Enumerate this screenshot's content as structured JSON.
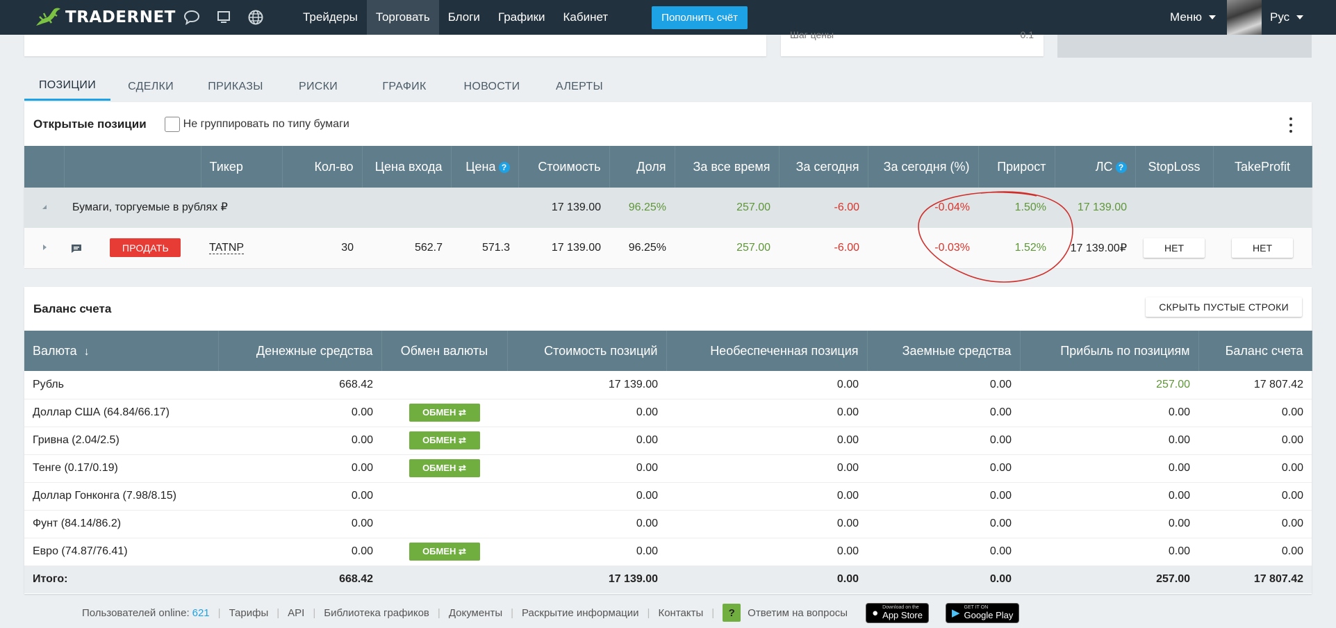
{
  "topbar": {
    "logo_text": "TRADERNET",
    "nav": [
      {
        "label": "Трейдеры"
      },
      {
        "label": "Торговать"
      },
      {
        "label": "Блоги"
      },
      {
        "label": "Графики"
      },
      {
        "label": "Кабинет"
      }
    ],
    "topup_label": "Пополнить счёт",
    "menu_label": "Меню",
    "lang_label": "Рус"
  },
  "remnant": {
    "label": "Шаг цены",
    "value": "0.1"
  },
  "tabs": [
    {
      "label": "ПОЗИЦИИ"
    },
    {
      "label": "СДЕЛКИ"
    },
    {
      "label": "ПРИКАЗЫ"
    },
    {
      "label": "РИСКИ"
    },
    {
      "label": "ГРАФИК"
    },
    {
      "label": "НОВОСТИ"
    },
    {
      "label": "АЛЕРТЫ"
    }
  ],
  "positions": {
    "title": "Открытые позиции",
    "no_group_label": "Не группировать по типу бумаги",
    "columns": [
      "Тикер",
      "Кол-во",
      "Цена входа",
      "Цена",
      "Стоимость",
      "Доля",
      "За все время",
      "За сегодня",
      "За сегодня (%)",
      "Прирост",
      "ЛС",
      "StopLoss",
      "TakeProfit"
    ],
    "help_glyph": "?",
    "group": {
      "name": "Бумаги, торгуемые в рублях ₽",
      "value": "17 139.00",
      "share": "96.25%",
      "all_time": "257.00",
      "today": "-6.00",
      "today_pct": "-0.04%",
      "growth": "1.50%",
      "ls": "17 139.00"
    },
    "row": {
      "sell_label": "ПРОДАТЬ",
      "ticker": "TATNP",
      "qty": "30",
      "entry_price": "562.7",
      "price": "571.3",
      "value": "17 139.00",
      "share": "96.25%",
      "all_time": "257.00",
      "today": "-6.00",
      "today_pct": "-0.03%",
      "growth": "1.52%",
      "ls": "17 139.00₽",
      "stoploss": "НЕТ",
      "takeprofit": "НЕТ"
    }
  },
  "balance": {
    "title": "Баланс счета",
    "hide_label": "СКРЫТЬ ПУСТЫЕ СТРОКИ",
    "sort_glyph": "↓",
    "columns": [
      "Валюта",
      "Денежные средства",
      "Обмен валюты",
      "Стоимость позиций",
      "Необеспеченная позиция",
      "Заемные средства",
      "Прибыль по позициям",
      "Баланс счета"
    ],
    "exchange_label": "ОБМЕН ⇄",
    "rows": [
      {
        "currency": "Рубль",
        "cash": "668.42",
        "positions": "17 139.00",
        "unsecured": "0.00",
        "borrowed": "0.00",
        "profit": "257.00",
        "total": "17 807.42"
      },
      {
        "currency": "Доллар США (64.84/66.17)",
        "cash": "0.00",
        "positions": "0.00",
        "unsecured": "0.00",
        "borrowed": "0.00",
        "profit": "0.00",
        "total": "0.00"
      },
      {
        "currency": "Гривна (2.04/2.5)",
        "cash": "0.00",
        "positions": "0.00",
        "unsecured": "0.00",
        "borrowed": "0.00",
        "profit": "0.00",
        "total": "0.00"
      },
      {
        "currency": "Тенге (0.17/0.19)",
        "cash": "0.00",
        "positions": "0.00",
        "unsecured": "0.00",
        "borrowed": "0.00",
        "profit": "0.00",
        "total": "0.00"
      },
      {
        "currency": "Доллар Гонконга (7.98/8.15)",
        "cash": "0.00",
        "positions": "0.00",
        "unsecured": "0.00",
        "borrowed": "0.00",
        "profit": "0.00",
        "total": "0.00"
      },
      {
        "currency": "Фунт (84.14/86.2)",
        "cash": "0.00",
        "positions": "0.00",
        "unsecured": "0.00",
        "borrowed": "0.00",
        "profit": "0.00",
        "total": "0.00"
      },
      {
        "currency": "Евро (74.87/76.41)",
        "cash": "0.00",
        "positions": "0.00",
        "unsecured": "0.00",
        "borrowed": "0.00",
        "profit": "0.00",
        "total": "0.00"
      }
    ],
    "total_row": {
      "label": "Итого:",
      "cash": "668.42",
      "positions": "17 139.00",
      "unsecured": "0.00",
      "borrowed": "0.00",
      "profit": "257.00",
      "total": "17 807.42"
    }
  },
  "footer": {
    "online_label": "Пользователей online:",
    "online_count": "621",
    "links": [
      "Тарифы",
      "API",
      "Библиотека графиков",
      "Документы",
      "Раскрытие информации",
      "Контакты"
    ],
    "help_glyph": "?",
    "help_label": "Ответим на вопросы",
    "appstore_small": "Download on the",
    "appstore_big": "App Store",
    "gplay_small": "GET IT ON",
    "gplay_big": "Google Play"
  },
  "colors": {
    "header_bg": "#21313d",
    "table_header": "#607d8b",
    "accent": "#1ea2e6",
    "sell": "#e73b35",
    "exchange": "#6fae3f",
    "positive": "#5e9638",
    "negative": "#d9342b",
    "annotation": "#d0302c"
  }
}
